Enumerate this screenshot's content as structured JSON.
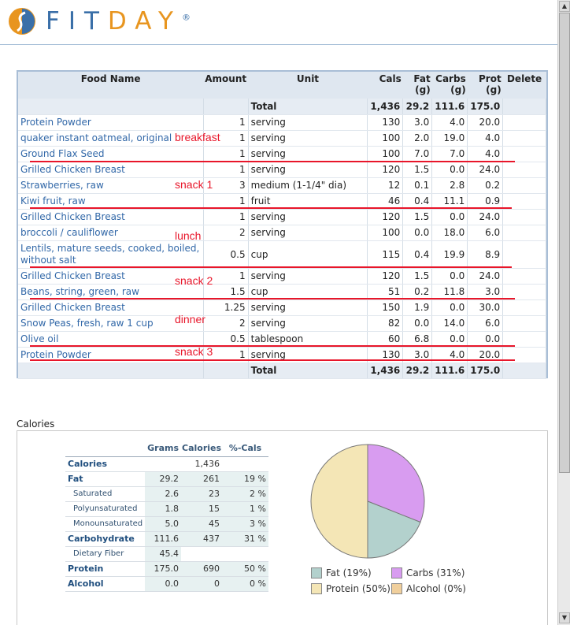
{
  "brand": {
    "name_part1": "FIT",
    "name_part2": "DAY",
    "reg": "®"
  },
  "food_table": {
    "headers": {
      "food_name": "Food Name",
      "amount": "Amount",
      "unit": "Unit",
      "cals": "Cals",
      "fat": "Fat",
      "fat_unit": "(g)",
      "carbs": "Carbs",
      "carbs_unit": "(g)",
      "prot": "Prot",
      "prot_unit": "(g)",
      "delete": "Delete"
    },
    "total": {
      "label": "Total",
      "cals": "1,436",
      "fat": "29.2",
      "carbs": "111.6",
      "prot": "175.0"
    },
    "rows": [
      {
        "name": "Protein Powder",
        "amount": "1",
        "unit": "serving",
        "cals": "130",
        "fat": "3.0",
        "carbs": "4.0",
        "prot": "20.0"
      },
      {
        "name": "quaker instant oatmeal, original",
        "amount": "1",
        "unit": "serving",
        "cals": "100",
        "fat": "2.0",
        "carbs": "19.0",
        "prot": "4.0"
      },
      {
        "name": "Ground Flax Seed",
        "amount": "1",
        "unit": "serving",
        "cals": "100",
        "fat": "7.0",
        "carbs": "7.0",
        "prot": "4.0"
      },
      {
        "name": "Grilled Chicken Breast",
        "amount": "1",
        "unit": "serving",
        "cals": "120",
        "fat": "1.5",
        "carbs": "0.0",
        "prot": "24.0"
      },
      {
        "name": "Strawberries, raw",
        "amount": "3",
        "unit": "medium (1-1/4\" dia)",
        "cals": "12",
        "fat": "0.1",
        "carbs": "2.8",
        "prot": "0.2"
      },
      {
        "name": "Kiwi fruit, raw",
        "amount": "1",
        "unit": "fruit",
        "cals": "46",
        "fat": "0.4",
        "carbs": "11.1",
        "prot": "0.9"
      },
      {
        "name": "Grilled Chicken Breast",
        "amount": "1",
        "unit": "serving",
        "cals": "120",
        "fat": "1.5",
        "carbs": "0.0",
        "prot": "24.0"
      },
      {
        "name": "broccoli / cauliflower",
        "amount": "2",
        "unit": "serving",
        "cals": "100",
        "fat": "0.0",
        "carbs": "18.0",
        "prot": "6.0"
      },
      {
        "name": "Lentils, mature seeds, cooked, boiled, without salt",
        "amount": "0.5",
        "unit": "cup",
        "cals": "115",
        "fat": "0.4",
        "carbs": "19.9",
        "prot": "8.9"
      },
      {
        "name": "Grilled Chicken Breast",
        "amount": "1",
        "unit": "serving",
        "cals": "120",
        "fat": "1.5",
        "carbs": "0.0",
        "prot": "24.0"
      },
      {
        "name": "Beans, string, green, raw",
        "amount": "1.5",
        "unit": "cup",
        "cals": "51",
        "fat": "0.2",
        "carbs": "11.8",
        "prot": "3.0"
      },
      {
        "name": "Grilled Chicken Breast",
        "amount": "1.25",
        "unit": "serving",
        "cals": "150",
        "fat": "1.9",
        "carbs": "0.0",
        "prot": "30.0"
      },
      {
        "name": "Snow Peas, fresh, raw 1 cup",
        "amount": "2",
        "unit": "serving",
        "cals": "82",
        "fat": "0.0",
        "carbs": "14.0",
        "prot": "6.0"
      },
      {
        "name": "Olive oil",
        "amount": "0.5",
        "unit": "tablespoon",
        "cals": "60",
        "fat": "6.8",
        "carbs": "0.0",
        "prot": "0.0"
      },
      {
        "name": "Protein Powder",
        "amount": "1",
        "unit": "serving",
        "cals": "130",
        "fat": "3.0",
        "carbs": "4.0",
        "prot": "20.0"
      }
    ]
  },
  "annotations": {
    "breakfast": "breakfast",
    "snack1": "snack 1",
    "lunch": "lunch",
    "snack2": "snack 2",
    "dinner": "dinner",
    "snack3": "snack 3",
    "color": "#e8162a"
  },
  "calories_panel": {
    "title": "Calories",
    "headers": {
      "grams": "Grams",
      "calories": "Calories",
      "pct": "%-Cals"
    },
    "rows": [
      {
        "label": "Calories",
        "grams": "",
        "calories": "1,436",
        "pct": ""
      },
      {
        "label": "Fat",
        "grams": "29.2",
        "calories": "261",
        "pct": "19 %"
      },
      {
        "label": "Saturated",
        "grams": "2.6",
        "calories": "23",
        "pct": "2 %"
      },
      {
        "label": "Polyunsaturated",
        "grams": "1.8",
        "calories": "15",
        "pct": "1 %"
      },
      {
        "label": "Monounsaturated",
        "grams": "5.0",
        "calories": "45",
        "pct": "3 %"
      },
      {
        "label": "Carbohydrate",
        "grams": "111.6",
        "calories": "437",
        "pct": "31 %"
      },
      {
        "label": "Dietary Fiber",
        "grams": "45.4",
        "calories": "",
        "pct": ""
      },
      {
        "label": "Protein",
        "grams": "175.0",
        "calories": "690",
        "pct": "50 %"
      },
      {
        "label": "Alcohol",
        "grams": "0.0",
        "calories": "0",
        "pct": "0 %"
      }
    ]
  },
  "chart_data": {
    "type": "pie",
    "labels": [
      "Fat",
      "Carbs",
      "Protein",
      "Alcohol"
    ],
    "values": [
      19,
      31,
      50,
      0
    ],
    "colors": [
      "#b3d1cd",
      "#d89cf0",
      "#f4e6b6",
      "#f0cf9c"
    ],
    "legend": [
      "Fat (19%)",
      "Carbs (31%)",
      "Protein (50%)",
      "Alcohol (0%)"
    ]
  }
}
